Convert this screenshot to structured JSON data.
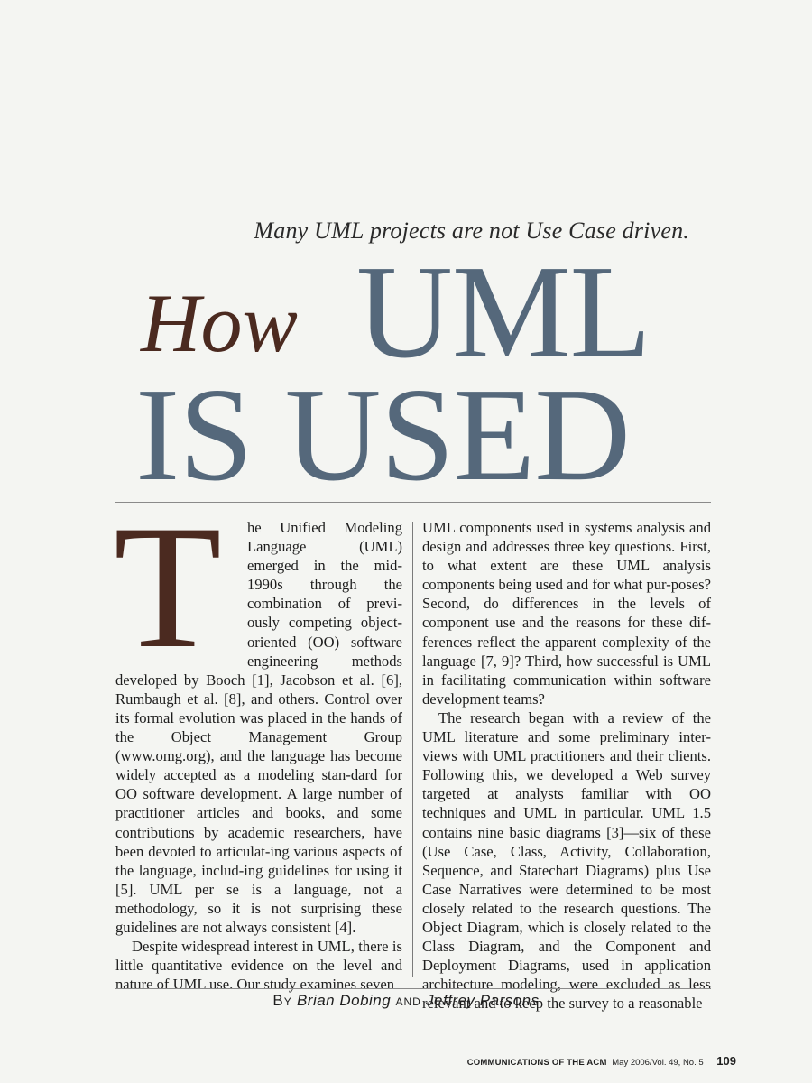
{
  "kicker": "Many UML projects are not Use Case driven.",
  "title": {
    "how": "How",
    "uml": "UML",
    "is_used": "IS USED"
  },
  "dropcap": "T",
  "left_column": [
    "he Unified Modeling Language (UML) emerged in the mid-1990s through the combination of previ-ously competing object-oriented (OO) software engineering methods developed by Booch [1], Jacobson et al. [6], Rumbaugh et al. [8], and others. Control over its formal evolution was placed in the hands of the Object Management Group (www.omg.org), and the language has become widely accepted as a modeling stan-dard for OO software development. A large number of practitioner articles and books, and some contributions by academic researchers, have been devoted to articulat-ing various aspects of the language, includ-ing guidelines for using it [5]. UML per se is a language, not a methodology, so it is not surprising these guidelines are not always consistent [4].",
    "Despite widespread interest in UML, there is little quantitative evidence on the level and nature of UML use. Our study examines seven"
  ],
  "right_column": [
    "UML components used in systems analysis and design and addresses three key questions. First, to what extent are these UML analysis components being used and for what pur-poses? Second, do differences in the levels of component use and the reasons for these dif-ferences reflect the apparent complexity of the language [7, 9]? Third, how successful is UML in facilitating communication within software development teams?",
    "The research began with a review of the UML literature and some preliminary inter-views with UML practitioners and their clients. Following this, we developed a Web survey targeted at analysts familiar with OO techniques and UML in particular. UML 1.5 contains nine basic diagrams [3]—six of these (Use Case, Class, Activity, Collaboration, Sequence, and Statechart Diagrams) plus Use Case Narratives were determined to be most closely related to the research questions. The Object Diagram, which is closely related to the Class Diagram, and the Component and Deployment Diagrams, used in application architecture modeling, were excluded as less relevant and to keep the survey to a reasonable"
  ],
  "byline": {
    "by": "By",
    "author1": "Brian Dobing",
    "and": "and",
    "author2": "Jeffrey Parsons"
  },
  "footer": {
    "journal": "COMMUNICATIONS OF THE ACM",
    "issue": "May 2006/Vol. 49, No. 5",
    "page": "109"
  },
  "colors": {
    "title_blue": "#55687b",
    "accent_brown": "#4b2a20"
  }
}
